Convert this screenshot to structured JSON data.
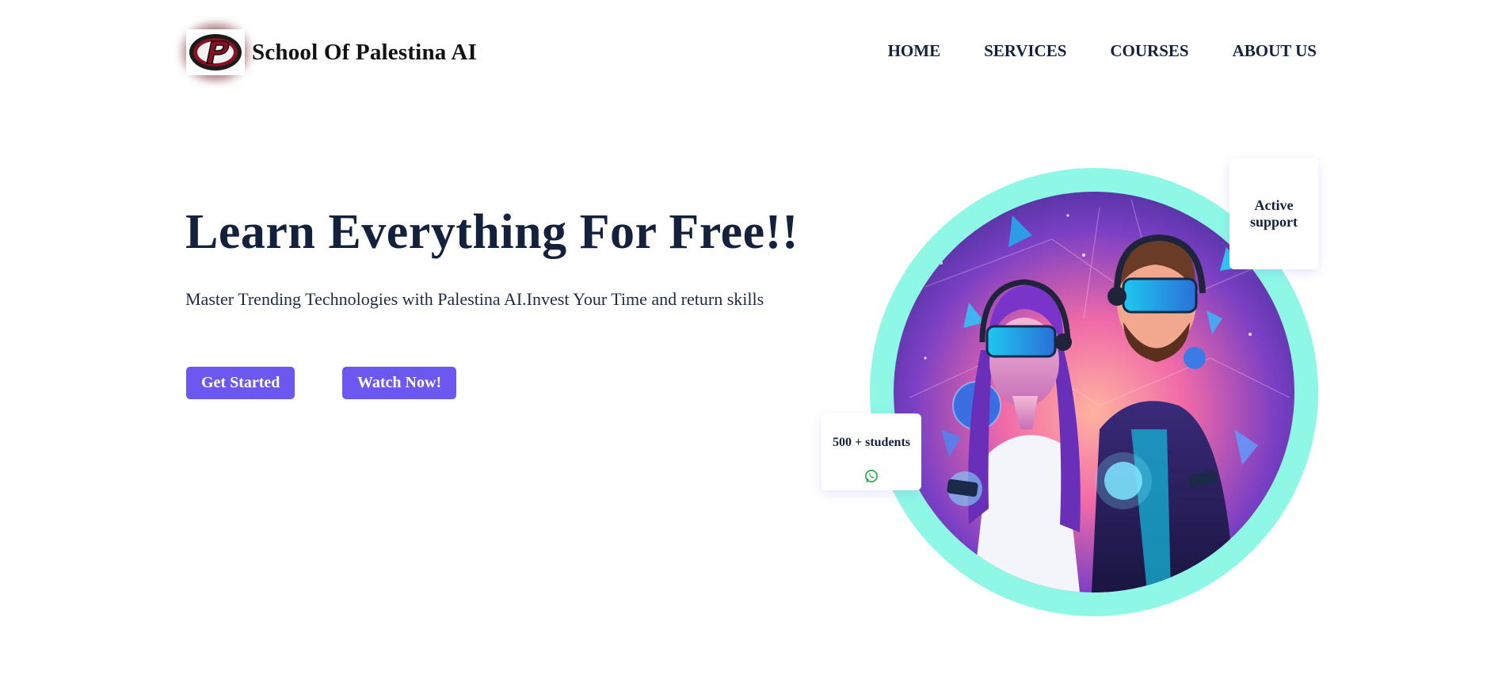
{
  "header": {
    "brand": "School Of Palestina AI",
    "logo_icon": "palestina-p-logo",
    "nav": [
      {
        "label": "HOME"
      },
      {
        "label": "SERVICES"
      },
      {
        "label": "COURSES"
      },
      {
        "label": "ABOUT US"
      }
    ]
  },
  "hero": {
    "title": "Learn Everything For Free!!",
    "subtitle": "Master Trending Technologies with Palestina AI.Invest Your Time and return skills",
    "buttons": {
      "get_started": "Get Started",
      "watch_now": "Watch Now!"
    }
  },
  "illustration": {
    "image": "vr-couple-neon-illustration",
    "support_card": "Active support",
    "students_card": "500 + students",
    "students_icon": "whatsapp-icon"
  },
  "colors": {
    "text_dark": "#14213d",
    "button": "#6c57f0",
    "ring": "#8ef7e6",
    "whatsapp": "#25a845"
  }
}
